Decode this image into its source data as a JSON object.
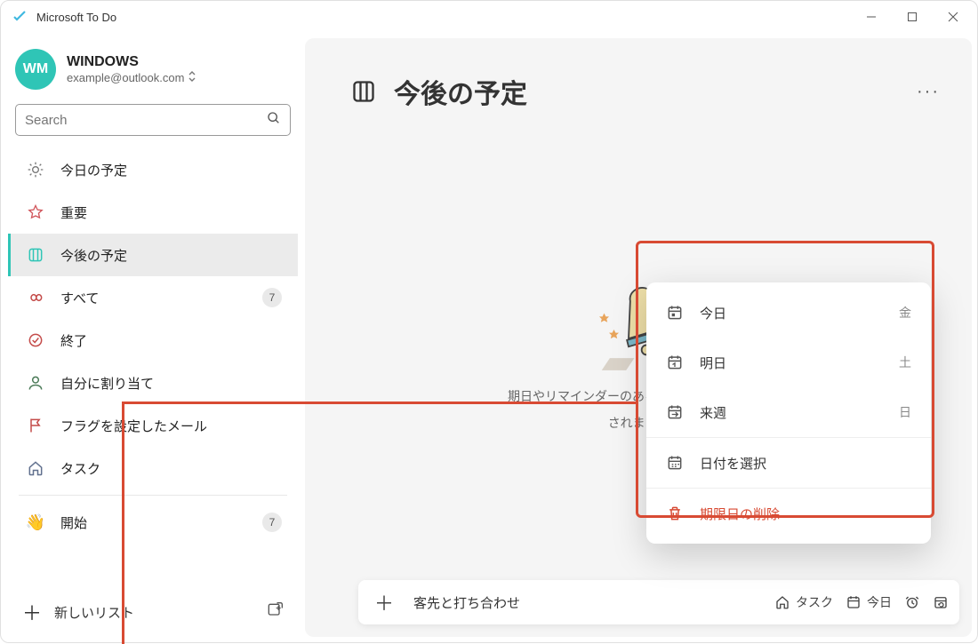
{
  "titlebar": {
    "title": "Microsoft To Do"
  },
  "account": {
    "initials": "WM",
    "name": "WINDOWS",
    "email": "example@outlook.com"
  },
  "search": {
    "placeholder": "Search"
  },
  "nav": {
    "today": {
      "label": "今日の予定"
    },
    "important": {
      "label": "重要"
    },
    "upcoming": {
      "label": "今後の予定"
    },
    "all": {
      "label": "すべて",
      "badge": "7"
    },
    "completed": {
      "label": "終了"
    },
    "assigned": {
      "label": "自分に割り当て"
    },
    "flagged": {
      "label": "フラグを設定したメール"
    },
    "tasks": {
      "label": "タスク"
    },
    "getting": {
      "label": "開始",
      "badge": "7"
    }
  },
  "newlist": {
    "label": "新しいリスト"
  },
  "main": {
    "title": "今後の予定",
    "empty_l1": "期日やリマインダーのあるタスクがここに表示",
    "empty_l2": "されます。"
  },
  "taskbar": {
    "value": "客先と打ち合わせ",
    "chips": {
      "tasks": "タスク",
      "today": "今日"
    }
  },
  "popup": {
    "today": {
      "label": "今日",
      "day": "金"
    },
    "tomorrow": {
      "label": "明日",
      "day": "土"
    },
    "nextweek": {
      "label": "来週",
      "day": "日"
    },
    "pick": {
      "label": "日付を選択"
    },
    "remove": {
      "label": "期限日の削除"
    }
  }
}
